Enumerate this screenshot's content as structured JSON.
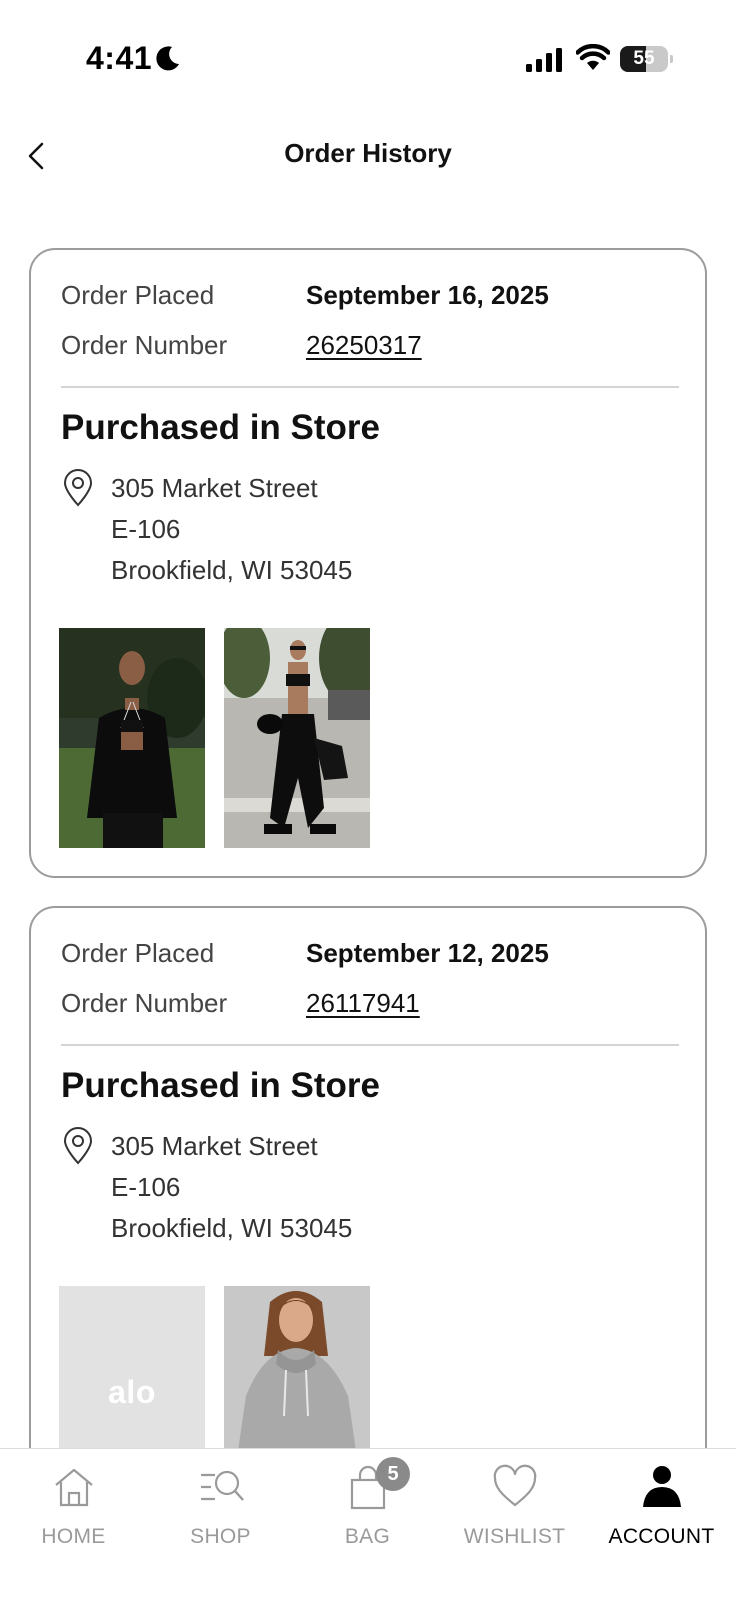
{
  "status_bar": {
    "time": "4:41",
    "battery_level": "55",
    "battery_fraction": 0.55
  },
  "header": {
    "title": "Order History"
  },
  "orders": [
    {
      "placed_label": "Order Placed",
      "placed_date": "September 16, 2025",
      "number_label": "Order Number",
      "order_number": "26250317",
      "purchase_type": "Purchased in Store",
      "address_line1": "305 Market Street",
      "address_line2": "E-106",
      "address_line3": "Brookfield, WI 53045"
    },
    {
      "placed_label": "Order Placed",
      "placed_date": "September 12, 2025",
      "number_label": "Order Number",
      "order_number": "26117941",
      "purchase_type": "Purchased in Store",
      "address_line1": "305 Market Street",
      "address_line2": "E-106",
      "address_line3": "Brookfield, WI 53045",
      "placeholder_logo": "alo"
    }
  ],
  "tab_bar": {
    "tabs": [
      {
        "label": "HOME",
        "icon": "home-icon"
      },
      {
        "label": "SHOP",
        "icon": "shop-search-icon"
      },
      {
        "label": "BAG",
        "icon": "bag-icon",
        "badge": "5"
      },
      {
        "label": "WISHLIST",
        "icon": "heart-icon"
      },
      {
        "label": "ACCOUNT",
        "icon": "account-icon",
        "active": true
      }
    ]
  },
  "colors": {
    "card_border": "#9c9c9c",
    "divider": "#d4d4d4",
    "inactive_tab": "#9a9a9a",
    "active_tab": "#000000",
    "badge": "#8a8a8a",
    "placeholder_bg": "#e2e2e2"
  }
}
